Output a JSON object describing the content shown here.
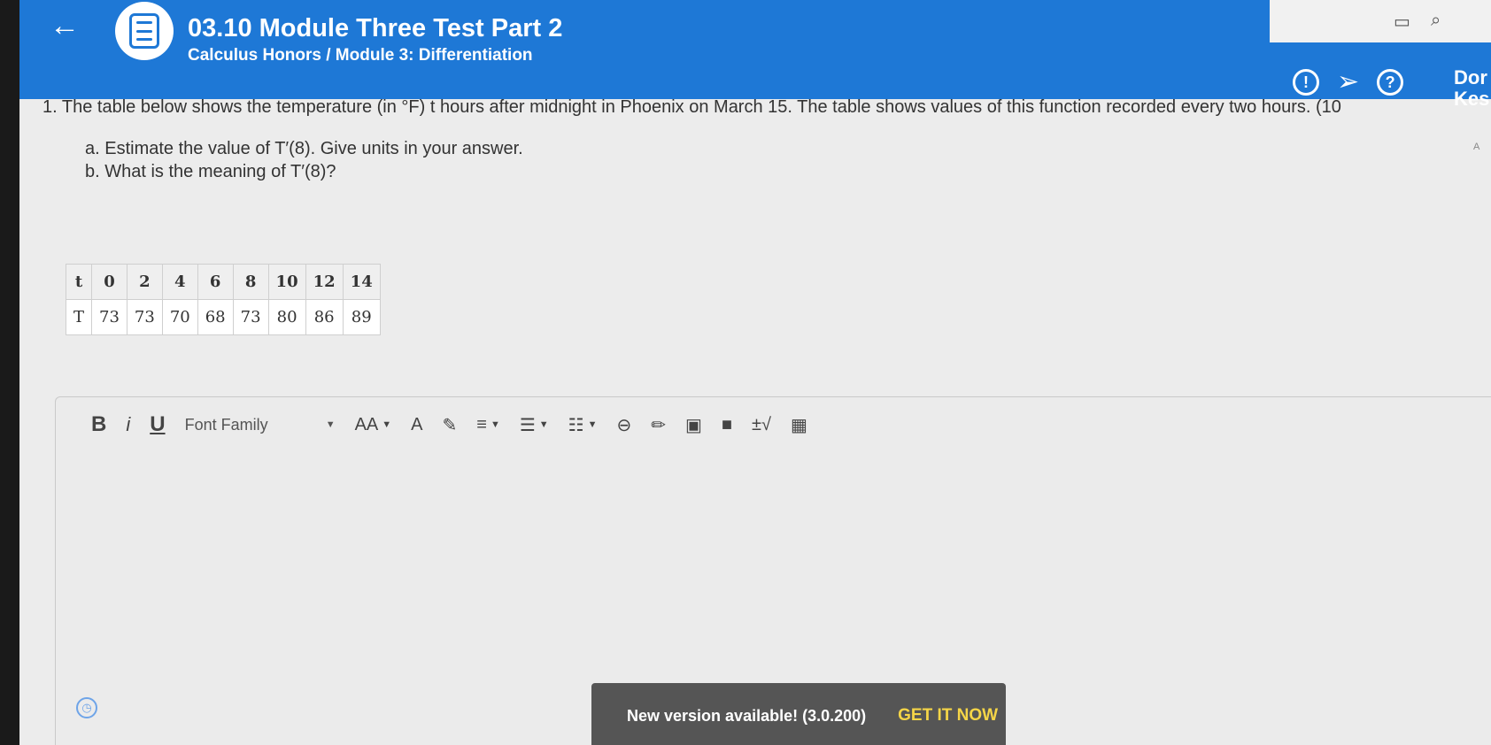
{
  "header": {
    "back_icon": "arrow-left-icon",
    "title": "03.10 Module Three Test Part 2",
    "breadcrumb": "Calculus Honors / Module 3: Differentiation",
    "icons": [
      "info-icon",
      "send-icon",
      "help-icon"
    ],
    "user_line1": "Dor",
    "user_line2": "Kes",
    "accent": "#1e78d6"
  },
  "question": {
    "line": "1. The table below shows the temperature (in °F) t hours after midnight in Phoenix on March 15. The table shows values of this function recorded every two hours. (10",
    "part_a": "a. Estimate the value of T′(8). Give units in your answer.",
    "part_b": "b. What is the meaning of T′(8)?",
    "side_label": "A"
  },
  "table": {
    "row_t": [
      "t",
      "0",
      "2",
      "4",
      "6",
      "8",
      "10",
      "12",
      "14"
    ],
    "row_T": [
      "T",
      "73",
      "73",
      "70",
      "68",
      "73",
      "80",
      "86",
      "89"
    ]
  },
  "editor": {
    "bold": "B",
    "italic": "i",
    "underline": "U",
    "font_family": "Font Family",
    "font_size": "AA"
  },
  "toast": {
    "message": "New version available! (3.0.200)",
    "button": "GET IT NOW",
    "button_color": "#f5d547"
  }
}
